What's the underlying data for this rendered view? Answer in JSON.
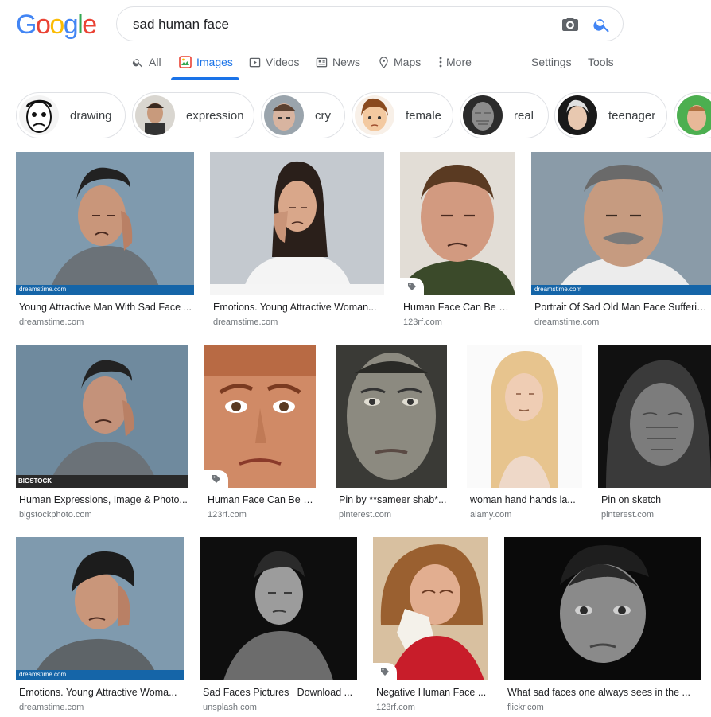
{
  "logo": {
    "letters": [
      "G",
      "o",
      "o",
      "g",
      "l",
      "e"
    ],
    "colors": [
      "#4285f4",
      "#ea4335",
      "#fbbc05",
      "#4285f4",
      "#34a853",
      "#ea4335"
    ]
  },
  "search": {
    "query": "sad human face"
  },
  "tabs": [
    {
      "label": "All",
      "icon": "search-icon"
    },
    {
      "label": "Images",
      "icon": "image-icon",
      "active": true
    },
    {
      "label": "Videos",
      "icon": "video-icon"
    },
    {
      "label": "News",
      "icon": "newspaper-icon"
    },
    {
      "label": "Maps",
      "icon": "map-pin-icon"
    },
    {
      "label": "More",
      "icon": "more-vert-icon"
    },
    {
      "label": "Settings"
    },
    {
      "label": "Tools"
    }
  ],
  "chips": [
    {
      "label": "drawing"
    },
    {
      "label": "expression"
    },
    {
      "label": "cry"
    },
    {
      "label": "female"
    },
    {
      "label": "real"
    },
    {
      "label": "teenager"
    }
  ],
  "results": [
    {
      "title": "Young Attractive Man With Sad Face ...",
      "domain": "dreamstime.com",
      "watermark": "dreamstime.com"
    },
    {
      "title": "Emotions. Young Attractive Woman...",
      "domain": "dreamstime.com"
    },
    {
      "title": "Human Face Can Be Di...",
      "domain": "123rf.com"
    },
    {
      "title": "Portrait Of Sad Old Man Face Suffering ...",
      "domain": "dreamstime.com",
      "watermark": "dreamstime.com"
    },
    {
      "title": "Human Expressions, Image & Photo...",
      "domain": "bigstockphoto.com",
      "watermark": "BIGSTOCK"
    },
    {
      "title": "Human Face Can Be Di...",
      "domain": "123rf.com"
    },
    {
      "title": "Pin by **sameer shab*...",
      "domain": "pinterest.com"
    },
    {
      "title": "woman hand hands la...",
      "domain": "alamy.com"
    },
    {
      "title": "Pin on sketch",
      "domain": "pinterest.com"
    },
    {
      "title": "Emotions. Young Attractive Woma...",
      "domain": "dreamstime.com",
      "watermark": "dreamstime.com"
    },
    {
      "title": "Sad Faces Pictures | Download ...",
      "domain": "unsplash.com"
    },
    {
      "title": "Negative Human Face ...",
      "domain": "123rf.com"
    },
    {
      "title": "What sad faces one always sees in the ...",
      "domain": "flickr.com"
    }
  ]
}
